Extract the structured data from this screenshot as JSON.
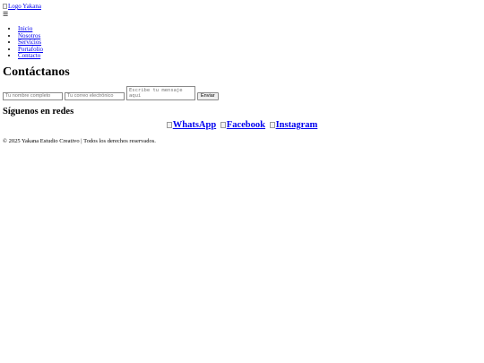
{
  "header": {
    "logo_alt": "Logo Yakana",
    "menu_toggle": "☰"
  },
  "nav": {
    "items": [
      {
        "label": "Inicio"
      },
      {
        "label": "Nosotros"
      },
      {
        "label": "Servicios"
      },
      {
        "label": "Portafolio"
      },
      {
        "label": "Contacto"
      }
    ]
  },
  "contact": {
    "title": "Contáctanos",
    "name_placeholder": "Tu nombre completo",
    "email_placeholder": "Tu correo electrónico",
    "message_placeholder": "Escribe tu mensaje aquí",
    "submit_label": "Enviar"
  },
  "social": {
    "title": "Síguenos en redes",
    "links": [
      {
        "label": "WhatsApp"
      },
      {
        "label": "Facebook"
      },
      {
        "label": "Instagram"
      }
    ]
  },
  "footer": {
    "text": "© 2025 Yakana Estudio Creativo | Todos los derechos reservados."
  },
  "colors": {
    "link": "#0000ee",
    "text": "#000000",
    "background": "#ffffff"
  }
}
